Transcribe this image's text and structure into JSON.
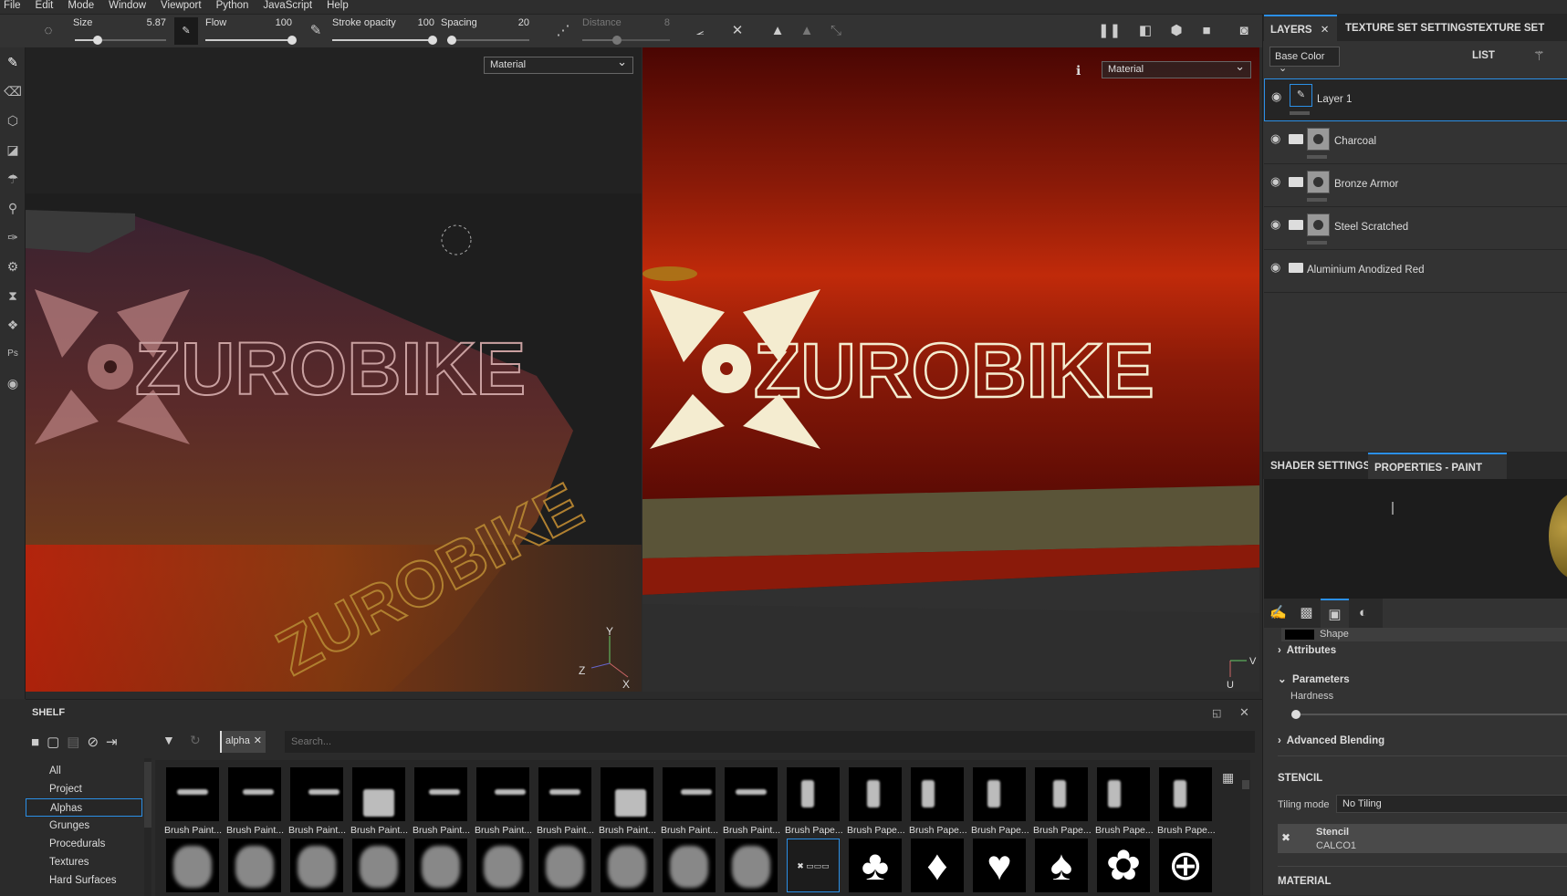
{
  "menu": [
    "File",
    "Edit",
    "Mode",
    "Window",
    "Viewport",
    "Python",
    "JavaScript",
    "Help"
  ],
  "toolbar": {
    "size_label": "Size",
    "size_value": "5.87",
    "size_fraction": 0.25,
    "flow_label": "Flow",
    "flow_value": "100",
    "flow_fraction": 1.0,
    "stroke_opacity_label": "Stroke opacity",
    "stroke_opacity_value": "100",
    "stroke_opacity_fraction": 1.0,
    "spacing_label": "Spacing",
    "spacing_value": "20",
    "spacing_fraction": 0.05,
    "distance_label": "Distance",
    "distance_value": "8",
    "distance_fraction": 0.4
  },
  "viewports": {
    "left_mode": "Material",
    "right_mode": "Material",
    "logo_text": "ZUROBIKE",
    "gizmo_left": {
      "x": "X",
      "y": "Y",
      "z": "Z"
    },
    "gizmo_right": {
      "u": "U",
      "v": "V"
    }
  },
  "shelf": {
    "title": "SHELF",
    "filter_tag": "alpha",
    "search_placeholder": "Search...",
    "categories": [
      "All",
      "Project",
      "Alphas",
      "Grunges",
      "Procedurals",
      "Textures",
      "Hard Surfaces"
    ],
    "selected_category": "Alphas",
    "row1_labels": [
      "Brush Paint...",
      "Brush Paint...",
      "Brush Paint...",
      "Brush Paint...",
      "Brush Paint...",
      "Brush Paint...",
      "Brush Paint...",
      "Brush Paint...",
      "Brush Paint...",
      "Brush Paint...",
      "Brush Pape...",
      "Brush Pape...",
      "Brush Pape...",
      "Brush Pape...",
      "Brush Pape...",
      "Brush Pape...",
      "Brush Pape..."
    ]
  },
  "layers_panel": {
    "tabs": [
      "LAYERS",
      "TEXTURE SET SETTINGS",
      "TEXTURE SET LIST"
    ],
    "channel": "Base Color",
    "layers": [
      {
        "name": "Layer 1",
        "type": "paint",
        "selected": true
      },
      {
        "name": "Charcoal",
        "type": "folder-mask"
      },
      {
        "name": "Bronze Armor",
        "type": "folder-mask"
      },
      {
        "name": "Steel Scratched",
        "type": "folder-mask"
      },
      {
        "name": "Aluminium Anodized Red",
        "type": "folder"
      }
    ]
  },
  "properties_panel": {
    "tabs": [
      "SHADER SETTINGS",
      "PROPERTIES - PAINT"
    ],
    "shape_label": "Shape",
    "attributes": "Attributes",
    "parameters": "Parameters",
    "hardness_label": "Hardness",
    "hardness_fraction": 0.0,
    "advanced_blending": "Advanced Blending",
    "stencil_header": "STENCIL",
    "tiling_mode_label": "Tiling mode",
    "tiling_mode_value": "No Tiling",
    "stencil_title": "Stencil",
    "stencil_name": "CALCO1",
    "material_header": "MATERIAL"
  }
}
